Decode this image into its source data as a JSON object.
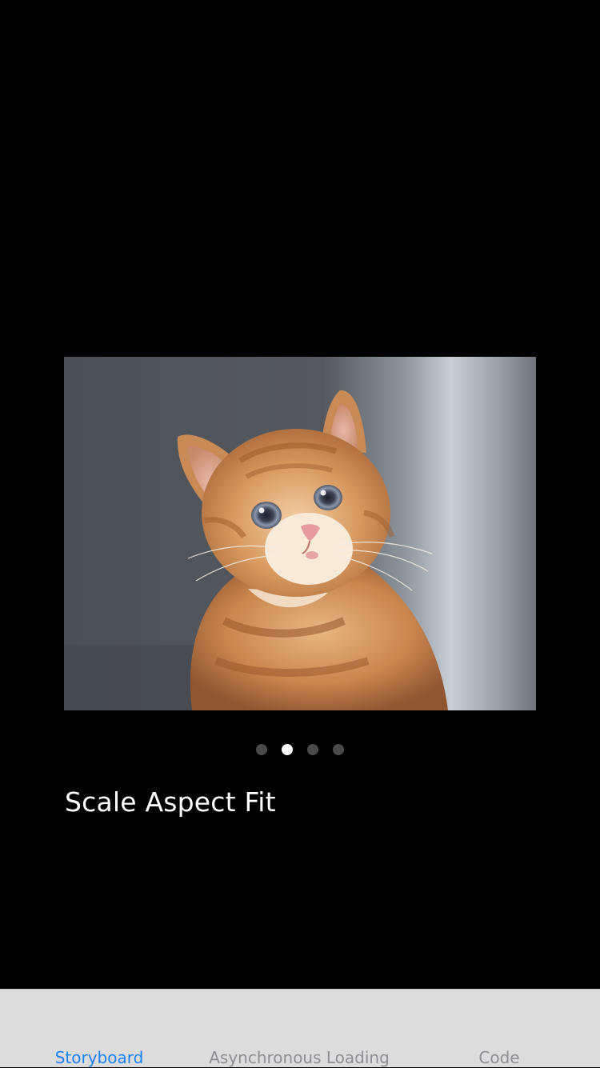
{
  "image_view": {
    "description_icon": "kitten-photo",
    "content_mode": "Scale Aspect Fit"
  },
  "page_control": {
    "page_count": 4,
    "current_page": 2,
    "active_color": "#ffffff",
    "inactive_color": "#4a4a4a"
  },
  "caption": {
    "text": "Scale Aspect Fit"
  },
  "tab_bar": {
    "selected_color": "#1a82f7",
    "unselected_color": "#8e8e93",
    "background_color": "#dcdcdc",
    "items": [
      {
        "label": "Storyboard",
        "selected": true
      },
      {
        "label": "Asynchronous Loading",
        "selected": false
      },
      {
        "label": "Code",
        "selected": false
      }
    ]
  }
}
